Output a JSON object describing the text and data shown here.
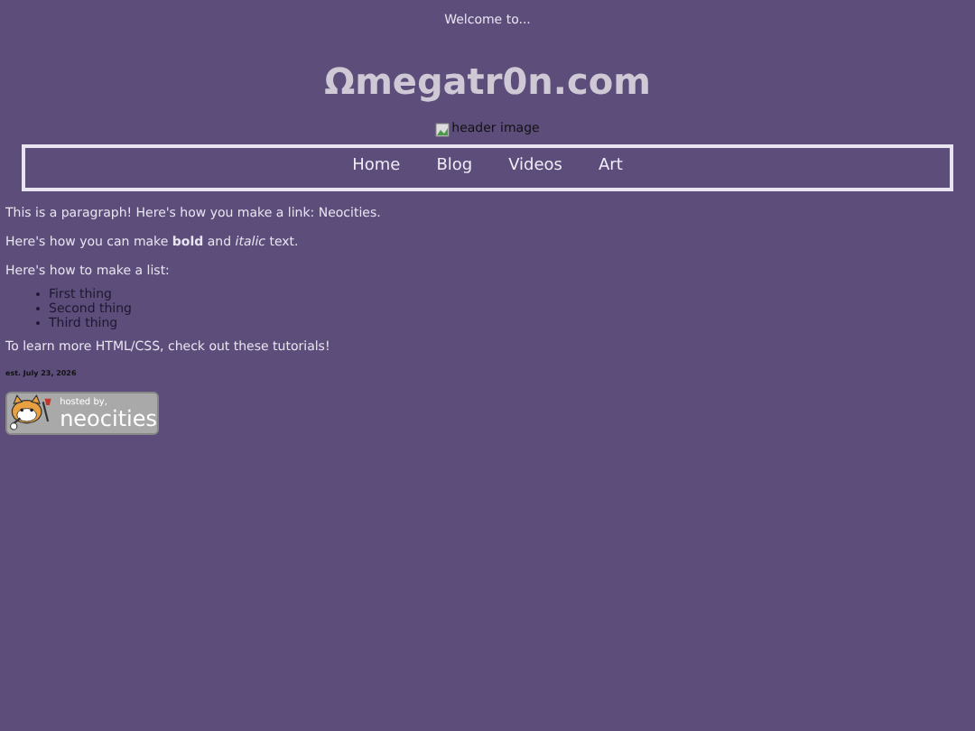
{
  "welcome": "Welcome to...",
  "title": "Ωmegatr0n.com",
  "header_image": {
    "alt": "header image"
  },
  "nav": [
    "Home",
    "Blog",
    "Videos",
    "Art"
  ],
  "paragraphs": [
    {
      "kind": "link",
      "before": "This is a paragraph! Here's how you make a link: ",
      "link": "Neocities",
      "after": "."
    },
    {
      "kind": "rich",
      "text": "Here's how you can make **bold** and *italic* text."
    },
    {
      "kind": "plain",
      "text": "Here's how to make a list:"
    }
  ],
  "list": [
    "First thing",
    "Second thing",
    "Third thing"
  ],
  "closing": "To learn more HTML/CSS, check out these tutorials!",
  "date": "est. July 23, 2026",
  "badge": {
    "line1": "hosted by,",
    "line2": "neocities"
  }
}
